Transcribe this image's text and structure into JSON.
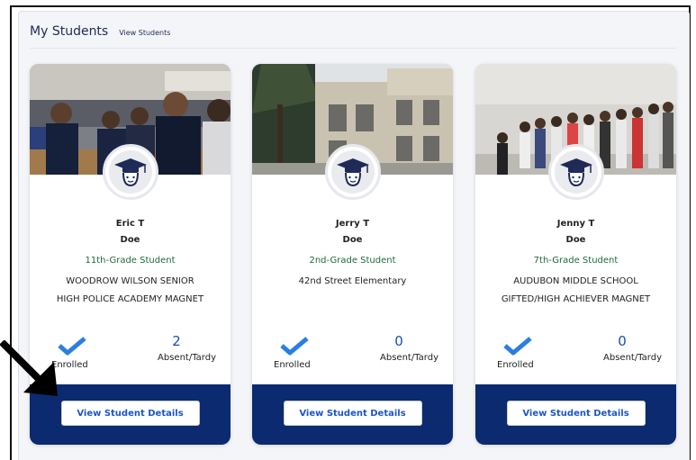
{
  "header": {
    "title": "My Students",
    "view_link": "View Students"
  },
  "icons": {
    "avatar": "graduation-cap-student-icon",
    "enrolled": "checkmark-icon",
    "annotation": "arrow-pointer-icon"
  },
  "colors": {
    "footer": "#0b2a70",
    "check": "#2a7fe0",
    "grade_text": "#1f6b3a",
    "button_text": "#1d55c7"
  },
  "students": [
    {
      "first_name": "Eric T",
      "last_name": "Doe",
      "grade": "11th-Grade Student",
      "school_line1": "WOODROW WILSON SENIOR",
      "school_line2": "HIGH POLICE ACADEMY MAGNET",
      "enrolled_label": "Enrolled",
      "absent_count": "2",
      "absent_label": "Absent/Tardy",
      "button_label": "View Student Details"
    },
    {
      "first_name": "Jerry T",
      "last_name": "Doe",
      "grade": "2nd-Grade Student",
      "school_line1": "42nd Street Elementary",
      "school_line2": "",
      "enrolled_label": "Enrolled",
      "absent_count": "0",
      "absent_label": "Absent/Tardy",
      "button_label": "View Student Details"
    },
    {
      "first_name": "Jenny T",
      "last_name": "Doe",
      "grade": "7th-Grade Student",
      "school_line1": "AUDUBON MIDDLE SCHOOL",
      "school_line2": "GIFTED/HIGH ACHIEVER MAGNET",
      "enrolled_label": "Enrolled",
      "absent_count": "0",
      "absent_label": "Absent/Tardy",
      "button_label": "View Student Details"
    }
  ]
}
